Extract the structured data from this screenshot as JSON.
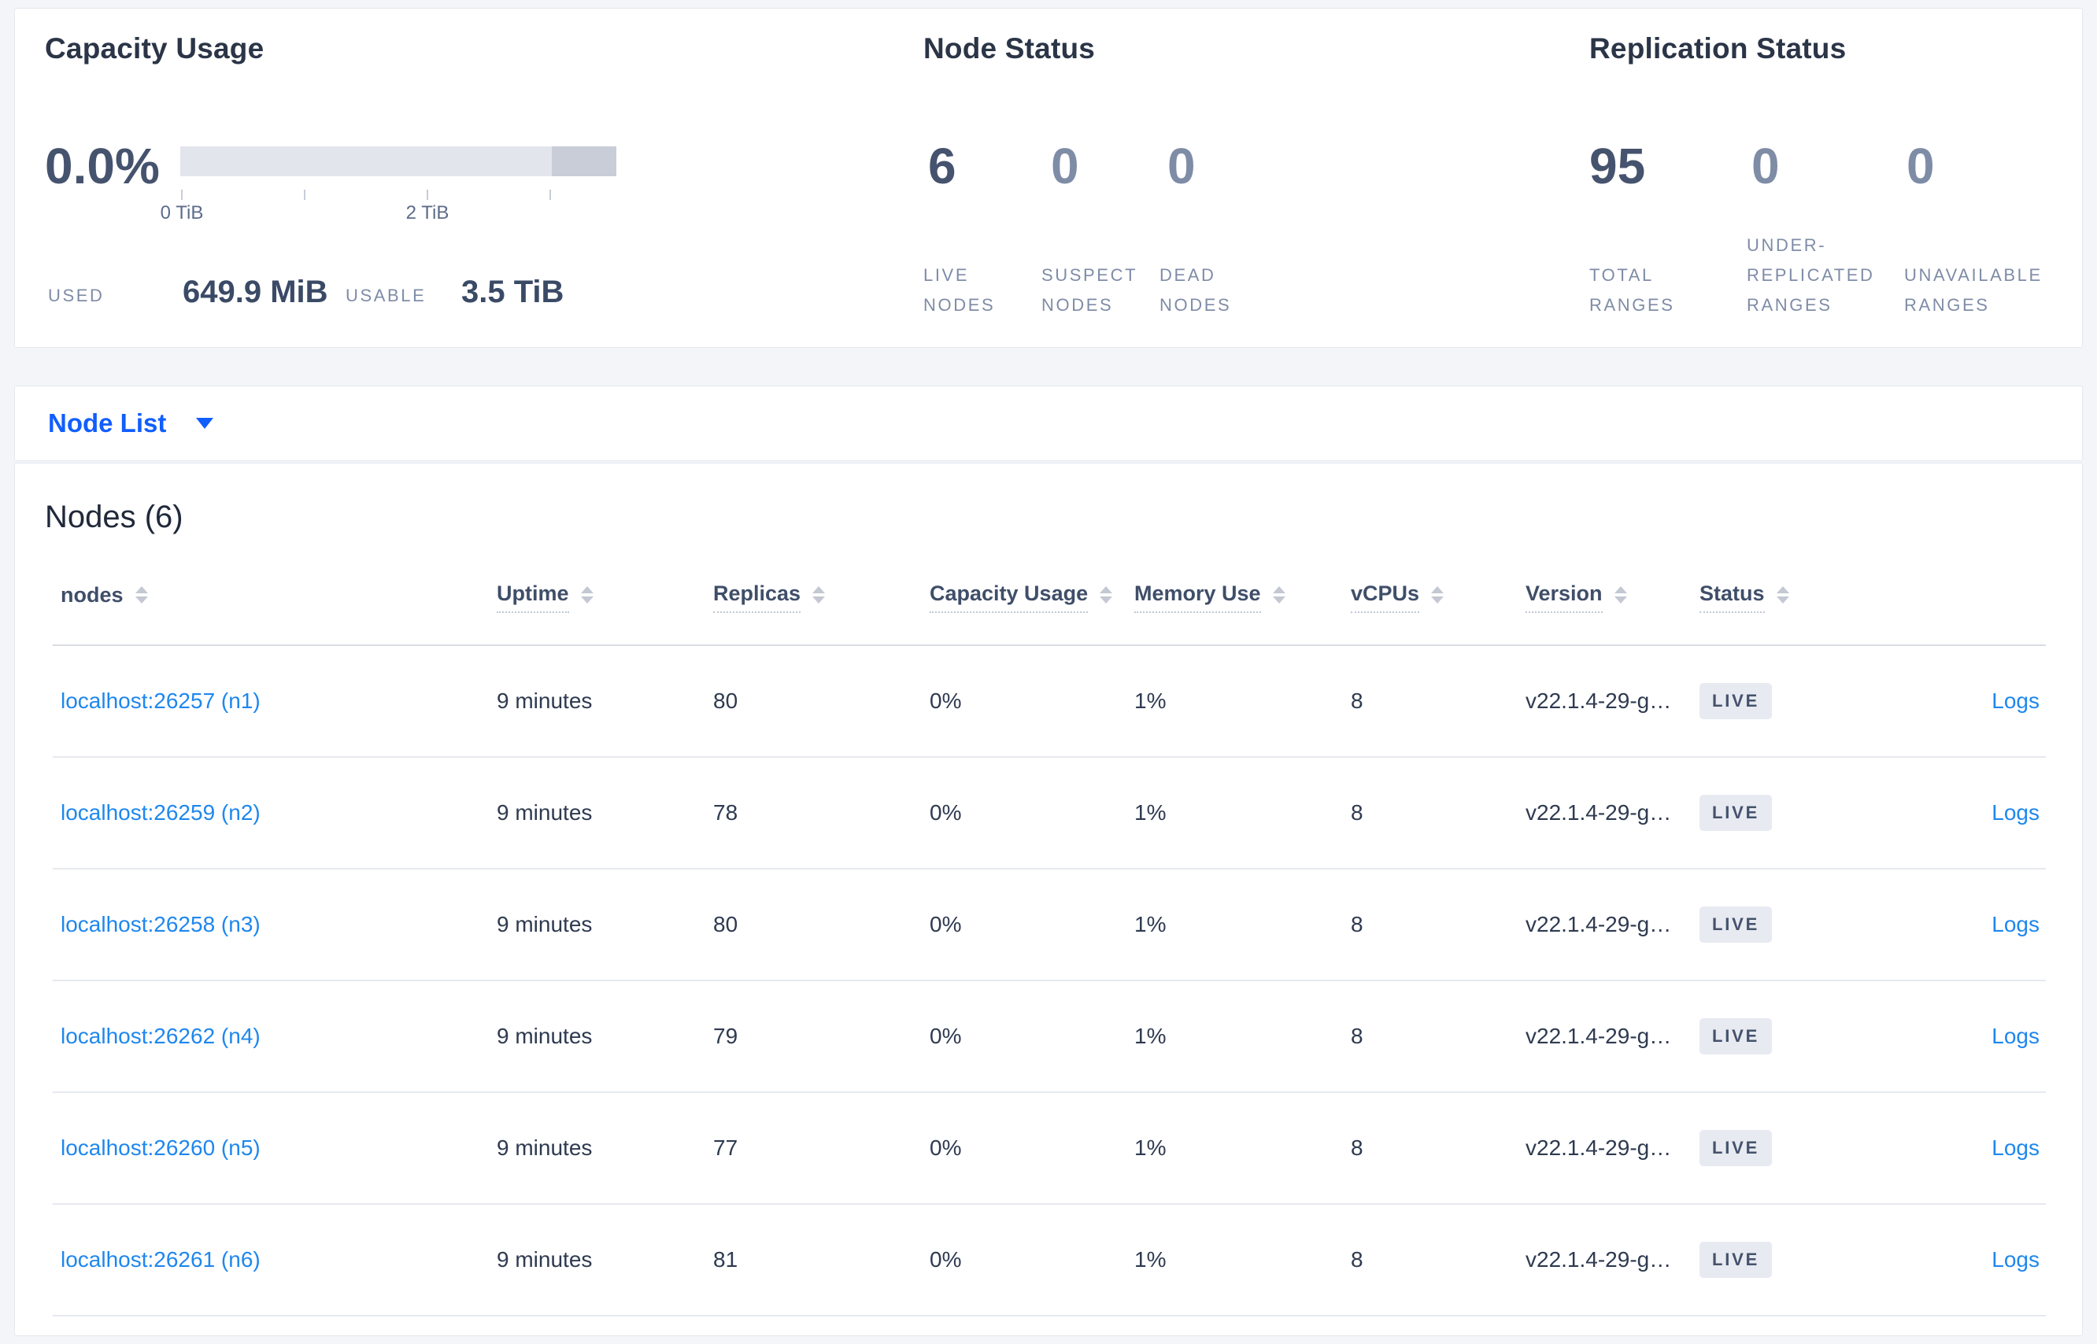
{
  "summary": {
    "capacity": {
      "title": "Capacity Usage",
      "percent": "0.0%",
      "tick_labels": [
        "0 TiB",
        "2 TiB"
      ],
      "used_label": "USED",
      "used_value": "649.9 MiB",
      "usable_label": "USABLE",
      "usable_value": "3.5 TiB"
    },
    "node_status": {
      "title": "Node Status",
      "metrics": [
        {
          "value": "6",
          "label": "LIVE NODES"
        },
        {
          "value": "0",
          "label": "SUSPECT NODES"
        },
        {
          "value": "0",
          "label": "DEAD NODES"
        }
      ]
    },
    "replication": {
      "title": "Replication Status",
      "metrics": [
        {
          "value": "95",
          "label": "TOTAL RANGES"
        },
        {
          "value": "0",
          "label": "UNDER-REPLICATED RANGES"
        },
        {
          "value": "0",
          "label": "UNAVAILABLE RANGES"
        }
      ]
    }
  },
  "node_list_dropdown": {
    "label": "Node List"
  },
  "nodes_table": {
    "title": "Nodes (6)",
    "logs_label": "Logs",
    "columns": [
      {
        "label": "nodes"
      },
      {
        "label": "Uptime"
      },
      {
        "label": "Replicas"
      },
      {
        "label": "Capacity Usage"
      },
      {
        "label": "Memory Use"
      },
      {
        "label": "vCPUs"
      },
      {
        "label": "Version"
      },
      {
        "label": "Status"
      }
    ],
    "rows": [
      {
        "node": "localhost:26257 (n1)",
        "uptime": "9 minutes",
        "replicas": "80",
        "capacity": "0%",
        "memory": "1%",
        "vcpus": "8",
        "version": "v22.1.4-29-g…",
        "status": "LIVE"
      },
      {
        "node": "localhost:26259 (n2)",
        "uptime": "9 minutes",
        "replicas": "78",
        "capacity": "0%",
        "memory": "1%",
        "vcpus": "8",
        "version": "v22.1.4-29-g…",
        "status": "LIVE"
      },
      {
        "node": "localhost:26258 (n3)",
        "uptime": "9 minutes",
        "replicas": "80",
        "capacity": "0%",
        "memory": "1%",
        "vcpus": "8",
        "version": "v22.1.4-29-g…",
        "status": "LIVE"
      },
      {
        "node": "localhost:26262 (n4)",
        "uptime": "9 minutes",
        "replicas": "79",
        "capacity": "0%",
        "memory": "1%",
        "vcpus": "8",
        "version": "v22.1.4-29-g…",
        "status": "LIVE"
      },
      {
        "node": "localhost:26260 (n5)",
        "uptime": "9 minutes",
        "replicas": "77",
        "capacity": "0%",
        "memory": "1%",
        "vcpus": "8",
        "version": "v22.1.4-29-g…",
        "status": "LIVE"
      },
      {
        "node": "localhost:26261 (n6)",
        "uptime": "9 minutes",
        "replicas": "81",
        "capacity": "0%",
        "memory": "1%",
        "vcpus": "8",
        "version": "v22.1.4-29-g…",
        "status": "LIVE"
      }
    ]
  },
  "colors": {
    "page_background": "#f3f5f9",
    "accent_blue": "#115eff",
    "link_blue": "#1e87ee",
    "badge_background": "#e7eaf0",
    "bar_light": "#e3e5ec",
    "bar_dark": "#c9cdd8",
    "big_number_dark": "#46536e",
    "big_number_dim": "#7e8ca6"
  }
}
